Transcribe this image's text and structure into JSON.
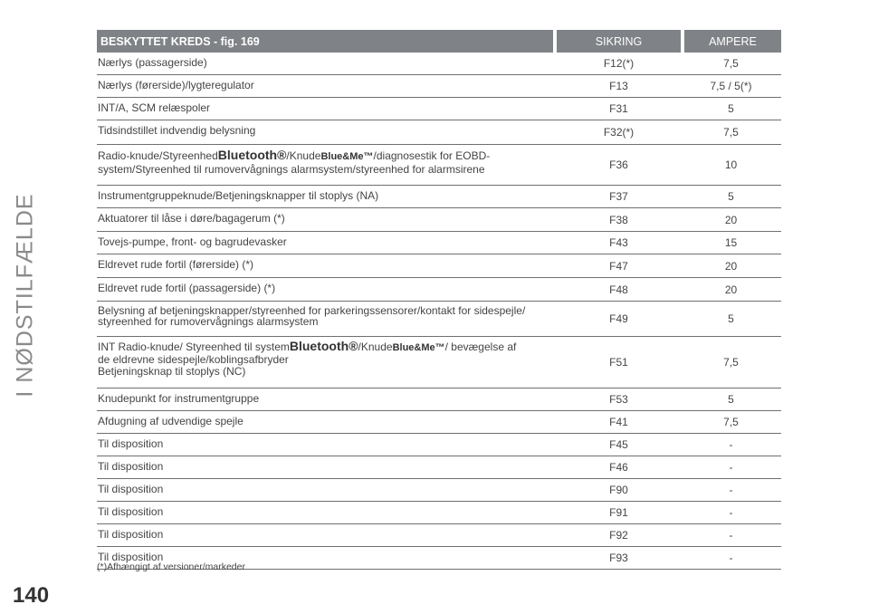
{
  "side_title": "I NØDSTILFÆLDE",
  "page_number": "140",
  "headers": {
    "circuit": "BESKYTTET KREDS - fig. 169",
    "fuse": "SIKRING",
    "ampere": "AMPERE"
  },
  "bt": "Bluetooth®",
  "bm": "Blue&Me™",
  "rows": [
    {
      "circuit": "Nærlys (passagerside)",
      "fuse": "F12",
      "fuse_note": "(*)",
      "amp": "7,5"
    },
    {
      "circuit": "Nærlys (førerside)/lygteregulator",
      "fuse": "F13",
      "amp": "7,5 / 5",
      "amp_note": "(*)"
    },
    {
      "circuit": "INT/A, SCM relæspoler",
      "fuse": "F31",
      "amp": "5"
    },
    {
      "circuit": "Tidsindstillet indvendig belysning",
      "fuse": "F32",
      "fuse_note": "(*)",
      "amp": "7,5"
    },
    {
      "circuit_a": "Radio-knude/Styreenhed",
      "circuit_b": "/Knude",
      "circuit_c": "/diagnosestik for EOBD-",
      "circuit_d": "system/Styreenhed til rumovervågnings alarmsystem/styreenhed for alarmsirene",
      "fuse": "F36",
      "amp": "10"
    },
    {
      "circuit": "Instrumentgruppeknude/Betjeningsknapper til stoplys (NA)",
      "fuse": "F37",
      "amp": "5"
    },
    {
      "circuit": "Aktuatorer til låse i døre/bagagerum",
      "circuit_note": "(*)",
      "fuse": "F38",
      "amp": "20"
    },
    {
      "circuit": "Tovejs-pumpe, front- og bagrudevasker",
      "fuse": "F43",
      "amp": "15"
    },
    {
      "circuit": "Eldrevet rude fortil (førerside)",
      "circuit_note": "(*)",
      "fuse": "F47",
      "amp": "20"
    },
    {
      "circuit": "Eldrevet rude fortil (passagerside)",
      "circuit_note": "(*)",
      "fuse": "F48",
      "amp": "20"
    },
    {
      "circuit_a": "Belysning af betjeningsknapper/styreenhed for parkeringssensorer/kontakt for sidespejle/",
      "circuit_b": "styreenhed for rumovervågnings alarmsystem",
      "fuse": "F49",
      "amp": "5"
    },
    {
      "circuit_a": "INT Radio-knude/ Styreenhed til system",
      "circuit_b": "/Knude",
      "circuit_c": "/ bevægelse af",
      "circuit_d": "de eldrevne sidespejle/koblingsafbryder",
      "circuit_e": "Betjeningsknap til stoplys (NC)",
      "fuse": "F51",
      "amp": "7,5"
    },
    {
      "circuit": "Knudepunkt for instrumentgruppe",
      "fuse": "F53",
      "amp": "5"
    },
    {
      "circuit": "Afdugning af udvendige spejle",
      "fuse": "F41",
      "amp": "7,5"
    },
    {
      "circuit": "Til disposition",
      "fuse": "F45",
      "amp": "-"
    },
    {
      "circuit": "Til disposition",
      "fuse": "F46",
      "amp": "-"
    },
    {
      "circuit": "Til disposition",
      "fuse": "F90",
      "amp": "-"
    },
    {
      "circuit": "Til disposition",
      "fuse": "F91",
      "amp": "-"
    },
    {
      "circuit": "Til disposition",
      "fuse": "F92",
      "amp": "-"
    },
    {
      "circuit": "Til disposition",
      "fuse": "F93",
      "amp": "-"
    }
  ],
  "footnote": "(*)Afhængigt af versioner/markeder"
}
